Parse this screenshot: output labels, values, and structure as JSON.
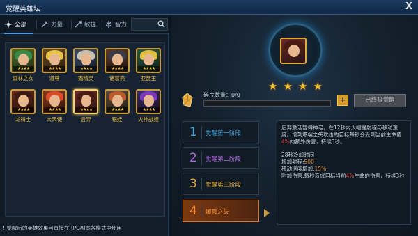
{
  "window": {
    "title": "觉醒英雄坛",
    "close_label": "X"
  },
  "tabs": [
    {
      "label": "全部",
      "icon": "all-icon",
      "active": true
    },
    {
      "label": "力量",
      "icon": "strength-icon",
      "active": false
    },
    {
      "label": "敏捷",
      "icon": "agility-icon",
      "active": false
    },
    {
      "label": "智力",
      "icon": "intelligence-icon",
      "active": false
    }
  ],
  "search": {
    "placeholder": ""
  },
  "heroes": [
    {
      "name": "森林之女",
      "stars": "★★★★",
      "hair": "#3a8a4a",
      "bg": "#4b6b2a"
    },
    {
      "name": "道尊",
      "stars": "★★★★",
      "hair": "#e8c24a",
      "bg": "#6a4a20"
    },
    {
      "name": "猫精灵",
      "stars": "★★★★",
      "hair": "#c9c0b0",
      "bg": "#3a4a6a"
    },
    {
      "name": "诸葛亮",
      "stars": "★★★★",
      "hair": "#3a3a4a",
      "bg": "#5a3a2a"
    },
    {
      "name": "亚瑟王",
      "stars": "★★★★",
      "hair": "#e0c040",
      "bg": "#2a5a4a"
    },
    {
      "name": "龙骑士",
      "stars": "★★★★",
      "hair": "#3a1a14",
      "bg": "#6a2a1a"
    },
    {
      "name": "大天使",
      "stars": "★★★★",
      "hair": "#d84a2a",
      "bg": "#8a3a1a"
    },
    {
      "name": "后羿",
      "stars": "★★★★",
      "hair": "#4a1a14",
      "bg": "#6a2a24"
    },
    {
      "name": "锯娃",
      "stars": "★★★★",
      "hair": "#b85a2a",
      "bg": "#5a4a3a"
    },
    {
      "name": "火神战姬",
      "stars": "★★★★",
      "hair": "#7a3ab8",
      "bg": "#3a2a6a"
    }
  ],
  "footer": {
    "note": "! 觉醒后的英雄效果可直接在RPG副本各模式中使用"
  },
  "detail": {
    "shard_label": "碎片数量：",
    "shard_value": "0/0",
    "plus_label": "+",
    "ultimate_label": "已终极觉醒",
    "star_count": 4,
    "stages": [
      {
        "num": "1",
        "label": "觉醒第一阶段",
        "color": "#3fa7e0",
        "active": false
      },
      {
        "num": "2",
        "label": "觉醒第二阶段",
        "color": "#b068e0",
        "active": false
      },
      {
        "num": "3",
        "label": "觉醒第三阶段",
        "color": "#e0a83a",
        "active": false
      },
      {
        "num": "4",
        "label": "爆裂之矢",
        "color": "#ff8a2a",
        "active": true
      }
    ],
    "desc": {
      "p1a": "后羿激活暂得神弓，在12秒内大幅提射程与移动速度。增到爆裂之矢攻击的目标每秒会受到当前生命值",
      "p1b": "4%",
      "p1c": "的额外伤害，持续3秒。",
      "lv": "28秒冷却时间",
      "range_label": "增加射程:",
      "range_val": "500",
      "speed_label": "移动速度增加:",
      "speed_val": "15%",
      "dmg_a": "附加伤害:每秒造成目标当前",
      "dmg_b": "4%",
      "dmg_c": "生命的伤害，持续3秒"
    }
  }
}
